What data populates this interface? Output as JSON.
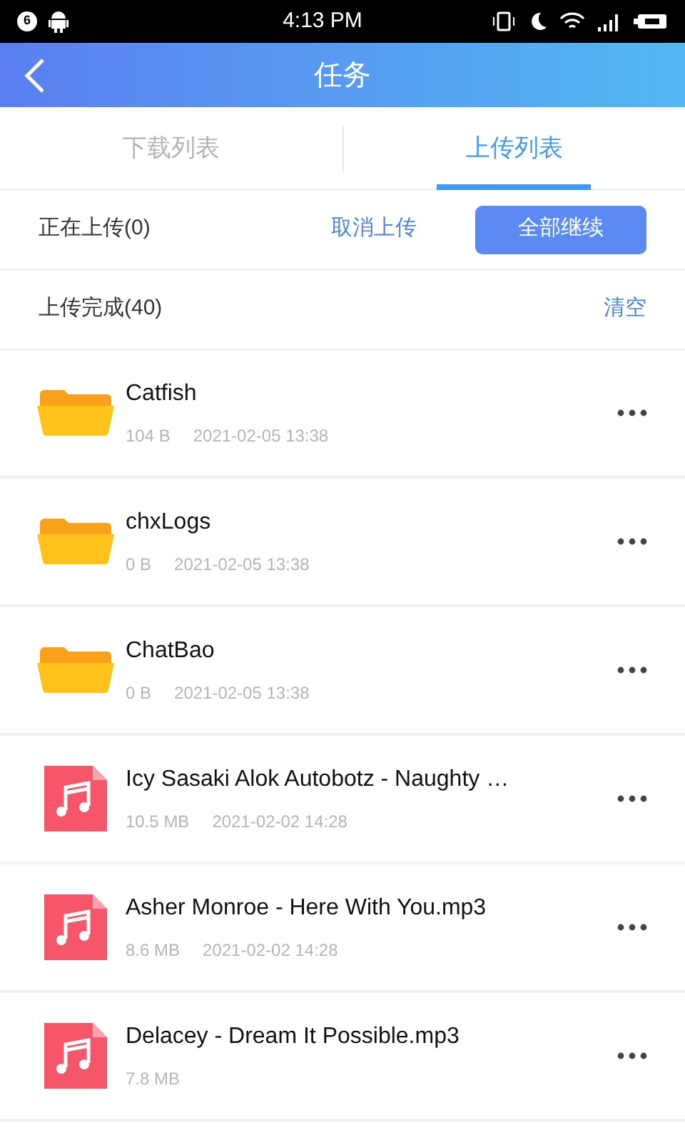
{
  "status_bar": {
    "notification_count": "6",
    "time": "4:13 PM"
  },
  "header": {
    "title": "任务"
  },
  "tabs": [
    {
      "label": "下载列表",
      "selected": false
    },
    {
      "label": "上传列表",
      "selected": true
    }
  ],
  "uploading": {
    "label": "正在上传(0)",
    "cancel": "取消上传",
    "resume_all": "全部继续"
  },
  "completed": {
    "label": "上传完成(40)",
    "clear": "清空"
  },
  "files": [
    {
      "kind": "folder",
      "name": "Catfish",
      "size": "104 B",
      "date": "2021-02-05 13:38"
    },
    {
      "kind": "folder",
      "name": "chxLogs",
      "size": "0 B",
      "date": "2021-02-05 13:38"
    },
    {
      "kind": "folder",
      "name": "ChatBao",
      "size": "0 B",
      "date": "2021-02-05 13:38"
    },
    {
      "kind": "audio",
      "name": "Icy Sasaki Alok Autobotz - Naughty …",
      "size": "10.5 MB",
      "date": "2021-02-02 14:28"
    },
    {
      "kind": "audio",
      "name": "Asher Monroe - Here With You.mp3",
      "size": "8.6 MB",
      "date": "2021-02-02 14:28"
    },
    {
      "kind": "audio",
      "name": "Delacey - Dream It Possible.mp3",
      "size": "7.8 MB"
    }
  ]
}
